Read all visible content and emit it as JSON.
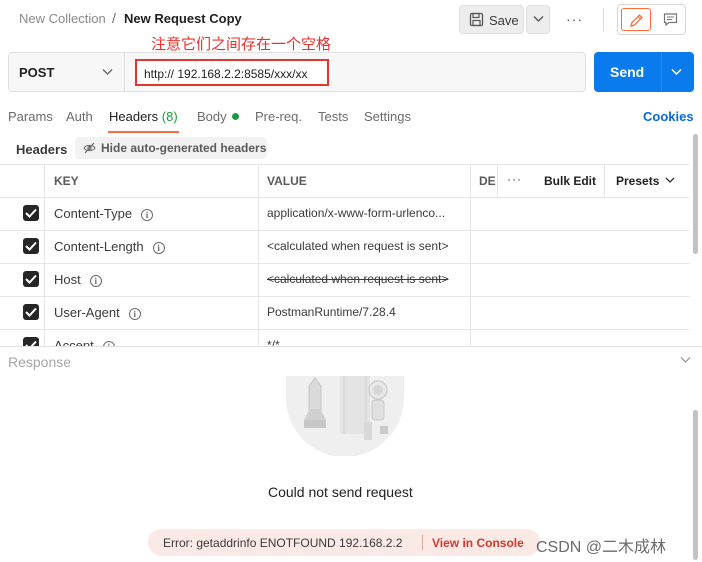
{
  "breadcrumb": {
    "parent": "New Collection",
    "separator": "/",
    "current": "New Request Copy"
  },
  "toolbar": {
    "save_label": "Save",
    "more": "···"
  },
  "annotation": "注意它们之间存在一个空格",
  "request": {
    "method": "POST",
    "url": "http:// 192.168.2.2:8585/xxx/xx",
    "send_label": "Send"
  },
  "tabs": [
    {
      "label": "Params"
    },
    {
      "label": "Auth"
    },
    {
      "label": "Headers",
      "count": "(8)"
    },
    {
      "label": "Body"
    },
    {
      "label": "Pre-req."
    },
    {
      "label": "Tests"
    },
    {
      "label": "Settings"
    }
  ],
  "cookies": "Cookies",
  "headers_section": {
    "title": "Headers",
    "hide_auto": "Hide auto-generated headers"
  },
  "table": {
    "columns": {
      "key": "KEY",
      "value": "VALUE",
      "description": "DE",
      "more": "···",
      "bulk_edit": "Bulk Edit",
      "presets": "Presets"
    },
    "rows": [
      {
        "key": "Content-Type",
        "value": "application/x-www-form-urlenco...",
        "checked": true,
        "struck": false
      },
      {
        "key": "Content-Length",
        "value": "<calculated when request is sent>",
        "checked": true,
        "struck": false
      },
      {
        "key": "Host",
        "value": "<calculated when request is sent>",
        "checked": true,
        "struck": true
      },
      {
        "key": "User-Agent",
        "value": "PostmanRuntime/7.28.4",
        "checked": true,
        "struck": false
      },
      {
        "key": "Accept",
        "value": "*/*",
        "checked": true,
        "struck": false
      }
    ]
  },
  "response": {
    "title": "Response",
    "empty_message": "Could not send request",
    "error_message": "Error: getaddrinfo ENOTFOUND  192.168.2.2",
    "console_link": "View in Console"
  },
  "watermark": "CSDN @二木成林",
  "colors": {
    "accent": "#ff6c37",
    "send": "#097bed",
    "link": "#0b6ad1",
    "error": "#d33a2c",
    "annotation": "#e8322c"
  }
}
